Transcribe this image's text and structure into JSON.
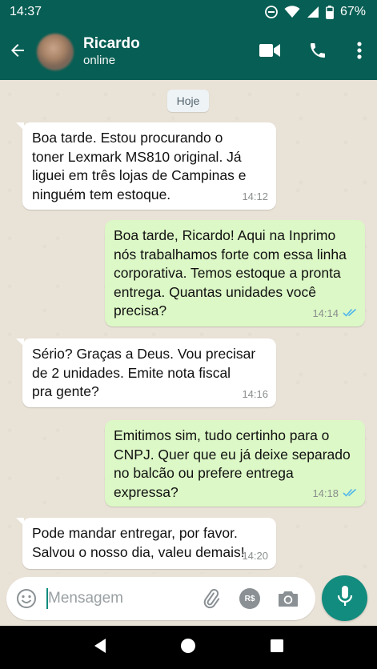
{
  "status_bar": {
    "time": "14:37",
    "battery": "67%",
    "icons": [
      "do-not-disturb-icon",
      "wifi-icon",
      "signal-icon",
      "battery-icon"
    ]
  },
  "header": {
    "contact_name": "Ricardo",
    "contact_status": "online",
    "icons": [
      "back-arrow-icon",
      "video-call-icon",
      "phone-icon",
      "more-vert-icon"
    ]
  },
  "chat": {
    "date_chip": "Hoje",
    "messages": [
      {
        "direction": "in",
        "lines": [
          "Boa tarde. Estou procurando o",
          "toner Lexmark MS810 original. Já",
          "liguei em três lojas de Campinas e",
          "ninguém tem estoque."
        ],
        "time": "14:12"
      },
      {
        "direction": "out",
        "lines": [
          "Boa tarde, Ricardo! Aqui na Inprimo",
          "nós trabalhamos forte com essa linha",
          "corporativa. Temos estoque a pronta",
          "entrega. Quantas unidades você",
          "precisa?"
        ],
        "time": "14:14",
        "status": "read"
      },
      {
        "direction": "in",
        "lines": [
          "Sério? Graças a Deus. Vou precisar",
          "de 2 unidades. Emite nota fiscal",
          "pra gente?"
        ],
        "time": "14:16"
      },
      {
        "direction": "out",
        "lines": [
          "Emitimos sim, tudo certinho para o",
          "CNPJ. Quer que eu já deixe separado",
          "no balcão ou prefere entrega",
          "expressa?"
        ],
        "time": "14:18",
        "status": "read"
      },
      {
        "direction": "in",
        "lines": [
          "Pode mandar entregar, por favor.",
          "Salvou o nosso dia, valeu demais!"
        ],
        "time": "14:20"
      }
    ]
  },
  "composer": {
    "placeholder": "Mensagem",
    "value": "",
    "payment_label": "R$",
    "icons": [
      "emoji-icon",
      "attach-icon",
      "payment-icon",
      "camera-icon",
      "mic-icon"
    ]
  },
  "colors": {
    "header": "#075e54",
    "accent": "#128c7e",
    "outgoing_bubble": "#dcf8c6",
    "incoming_bubble": "#ffffff",
    "read_ticks": "#4fb6ec"
  }
}
